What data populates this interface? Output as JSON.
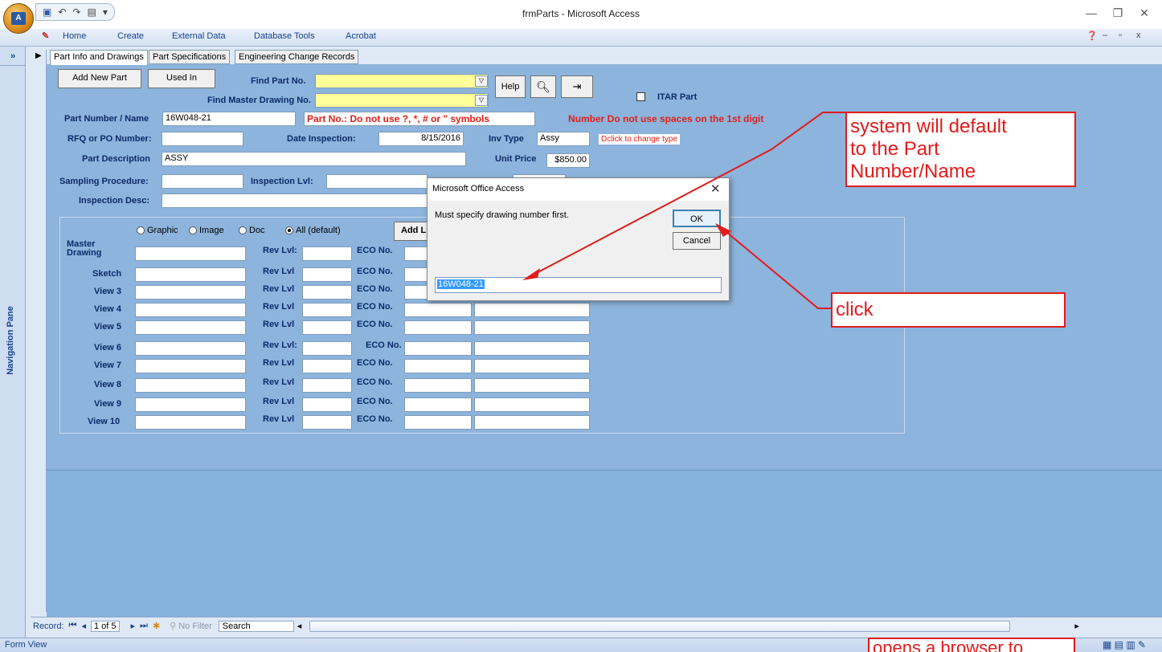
{
  "window": {
    "title": "frmParts - Microsoft Access",
    "minimize": "—",
    "restore": "❐",
    "close": "✕"
  },
  "ribbon": {
    "tabs": [
      "Home",
      "Create",
      "External Data",
      "Database Tools",
      "Acrobat"
    ]
  },
  "nav_pane": {
    "toggle": "»",
    "label": "Navigation Pane"
  },
  "form": {
    "tabs": [
      "Part Info and Drawings",
      "Part Specifications",
      "Engineering Change Records"
    ],
    "buttons": {
      "add_new_part": "Add New Part",
      "used_in": "Used In",
      "help": "Help",
      "add_link": "Add L"
    },
    "find_part_label": "Find Part No.",
    "find_drawing_label": "Find Master Drawing No.",
    "itar_label": "ITAR Part",
    "part_number_label": "Part Number / Name",
    "part_number_value": "16W048-21",
    "part_warning": "Part No.: Do not use ?, *, # or \" symbols",
    "space_warning": "Number Do not use spaces on the 1st digit",
    "rfq_label": "RFQ or PO Number:",
    "date_label": "Date  Inspection:",
    "date_value": "8/15/2016",
    "inv_type_label": "Inv Type",
    "inv_type_value": "Assy",
    "dclick_note": "Dclick to change type",
    "description_label": "Part Description",
    "description_value": "ASSY",
    "unit_price_label": "Unit Price",
    "unit_price_value": "$850.00",
    "sampling_label": "Sampling Procedure:",
    "inspection_lvl_label": "Inspection Lvl:",
    "inspection_desc_label": "Inspection Desc:",
    "radios": [
      {
        "label": "Graphic",
        "selected": false
      },
      {
        "label": "Image",
        "selected": false
      },
      {
        "label": "Doc",
        "selected": false
      },
      {
        "label": "All (default)",
        "selected": true
      }
    ],
    "drawing_rows": [
      {
        "label": "Master Drawing",
        "rev": "Rev Lvl:",
        "eco": "ECO No."
      },
      {
        "label": "Sketch",
        "rev": "Rev Lvl",
        "eco": "ECO No."
      },
      {
        "label": "View 3",
        "rev": "Rev Lvl",
        "eco": "ECO No."
      },
      {
        "label": "View 4",
        "rev": "Rev Lvl",
        "eco": "ECO No."
      },
      {
        "label": "View 5",
        "rev": "Rev Lvl",
        "eco": "ECO No."
      },
      {
        "label": "View 6",
        "rev": "Rev Lvl:",
        "eco": "ECO No."
      },
      {
        "label": "View 7",
        "rev": "Rev Lvl",
        "eco": "ECO No."
      },
      {
        "label": "View 8",
        "rev": "Rev Lvl",
        "eco": "ECO No."
      },
      {
        "label": "View 9",
        "rev": "Rev Lvl",
        "eco": "ECO No."
      },
      {
        "label": "View 10",
        "rev": "Rev Lvl",
        "eco": "ECO No."
      }
    ]
  },
  "dialog": {
    "title": "Microsoft Office Access",
    "message": "Must specify drawing number first.",
    "ok": "OK",
    "cancel": "Cancel",
    "input_value": "16W048-21"
  },
  "record_nav": {
    "label": "Record:",
    "position": "1 of 5",
    "filter": "No Filter",
    "search": "Search"
  },
  "status_bar": {
    "view": "Form View"
  },
  "annotations": {
    "default_note": [
      "system will default",
      "to the Part",
      "Number/Name"
    ],
    "click_note": "click",
    "browser_note": "opens a browser to"
  },
  "colors": {
    "form_background": "#8db4dc",
    "annotation_red": "#e21b1b",
    "find_field_yellow": "#ffff99",
    "warning_red": "#e0201a"
  }
}
